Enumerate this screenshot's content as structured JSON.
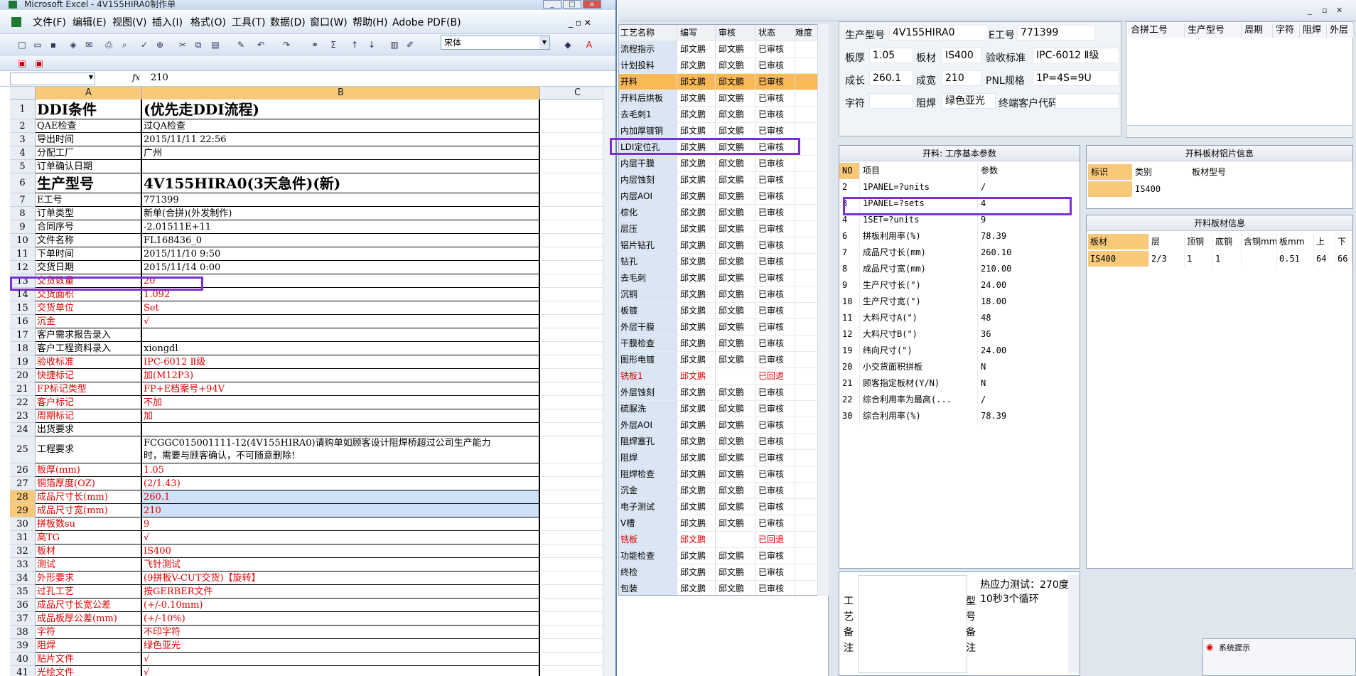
{
  "excel": {
    "title": "Microsoft Excel - 4V155HIRA0制作单",
    "window_buttons": [
      "_",
      "□",
      "×"
    ],
    "menu": [
      "文件(F)",
      "编辑(E)",
      "视图(V)",
      "插入(I)",
      "格式(O)",
      "工具(T)",
      "数据(D)",
      "窗口(W)",
      "帮助(H)",
      "Adobe PDF(B)"
    ],
    "font_name": "宋体",
    "formula_value": "210",
    "fx": "fx",
    "columns": [
      "A",
      "B",
      "C"
    ],
    "rows": [
      {
        "n": "1",
        "a": "DDI条件",
        "b": "(优先走DDI流程)",
        "big": true,
        "h": 28
      },
      {
        "n": "2",
        "a": "QAE检查",
        "b": "过QA检查",
        "h": 19
      },
      {
        "n": "3",
        "a": "导出时间",
        "b": "2015/11/11 22:56",
        "h": 19
      },
      {
        "n": "4",
        "a": "分配工厂",
        "b": "广州",
        "h": 19
      },
      {
        "n": "5",
        "a": "订单确认日期",
        "b": "",
        "h": 19
      },
      {
        "n": "6",
        "a": "生产型号",
        "b": "4V155HIRA0(3天急件)(新)",
        "big": true,
        "h": 28
      },
      {
        "n": "7",
        "a": "E工号",
        "b": "771399",
        "h": 19
      },
      {
        "n": "8",
        "a": "订单类型",
        "b": "新单(合拼)(外发制作)",
        "h": 19
      },
      {
        "n": "9",
        "a": "合同序号",
        "b": "-2.01511E+11",
        "h": 19
      },
      {
        "n": "10",
        "a": "文件名称",
        "b": "FL168436_0",
        "h": 19
      },
      {
        "n": "11",
        "a": "下单时间",
        "b": "2015/11/10 9:50",
        "h": 19
      },
      {
        "n": "12",
        "a": "交货日期",
        "b": "2015/11/14 0:00",
        "h": 19
      },
      {
        "n": "13",
        "a": "交货数量",
        "b": "20",
        "red": true,
        "h": 19
      },
      {
        "n": "14",
        "a": "交货面积",
        "b": "1.092",
        "red": true,
        "h": 19
      },
      {
        "n": "15",
        "a": "交货单位",
        "b": "Set",
        "red": true,
        "h": 19
      },
      {
        "n": "16",
        "a": "沉金",
        "b": "√",
        "red": true,
        "h": 19
      },
      {
        "n": "17",
        "a": "客户需求报告录入",
        "b": "",
        "h": 19
      },
      {
        "n": "18",
        "a": "客户工程资料录入",
        "b": "xiongdl",
        "h": 19
      },
      {
        "n": "19",
        "a": "验收标准",
        "b": "IPC-6012 Ⅱ级",
        "red": true,
        "h": 19
      },
      {
        "n": "20",
        "a": "快捷标记",
        "b": "加(M12P3)",
        "red": true,
        "h": 19
      },
      {
        "n": "21",
        "a": "FP标记类型",
        "b": "FP+E档案号+94V",
        "red": true,
        "h": 19
      },
      {
        "n": "22",
        "a": "客户标记",
        "b": "不加",
        "red": true,
        "h": 19
      },
      {
        "n": "23",
        "a": "周期标记",
        "b": "加",
        "red": true,
        "h": 19
      },
      {
        "n": "24",
        "a": "出货要求",
        "b": "",
        "h": 19
      },
      {
        "n": "25",
        "a": "工程要求",
        "b": "FCGGC015001111-12(4V155HIRA0)请购单如顾客设计阻焊桥超过公司生产能力",
        "b2": "时，需要与顾客确认，不可随意删除!",
        "h": 38
      },
      {
        "n": "26",
        "a": "板厚(mm)",
        "b": "1.05",
        "red": true,
        "h": 19
      },
      {
        "n": "27",
        "a": "铜箔厚度(OZ)",
        "b": "(2/1.43)",
        "red": true,
        "h": 19
      },
      {
        "n": "28",
        "a": "成品尺寸长(mm)",
        "b": "260.1",
        "red": true,
        "sel": true,
        "h": 19
      },
      {
        "n": "29",
        "a": "成品尺寸宽(mm)",
        "b": "210",
        "red": true,
        "sel": true,
        "h": 19
      },
      {
        "n": "30",
        "a": "拼板数su",
        "b": "9",
        "red": true,
        "h": 19
      },
      {
        "n": "31",
        "a": "高TG",
        "b": "√",
        "red": true,
        "h": 19
      },
      {
        "n": "32",
        "a": "板材",
        "b": "IS400",
        "red": true,
        "h": 19
      },
      {
        "n": "33",
        "a": "测试",
        "b": "飞针测试",
        "red": true,
        "h": 19
      },
      {
        "n": "34",
        "a": "外形要求",
        "b": "(9拼板V-CUT交货)【旋转】",
        "red": true,
        "h": 19
      },
      {
        "n": "35",
        "a": "过孔工艺",
        "b": "按GERBER文件",
        "red": true,
        "h": 19
      },
      {
        "n": "36",
        "a": "成品尺寸长宽公差",
        "b": "(+/-0.10mm)",
        "red": true,
        "h": 19
      },
      {
        "n": "37",
        "a": "成品板厚公差(mm)",
        "b": "(+/-10%)",
        "red": true,
        "h": 19
      },
      {
        "n": "38",
        "a": "字符",
        "b": "不印字符",
        "red": true,
        "h": 19
      },
      {
        "n": "39",
        "a": "阻焊",
        "b": "绿色亚光",
        "red": true,
        "h": 19
      },
      {
        "n": "40",
        "a": "贴片文件",
        "b": "√",
        "red": true,
        "h": 19
      },
      {
        "n": "41",
        "a": "光绘文件",
        "b": "√",
        "red": true,
        "h": 19
      }
    ]
  },
  "process": {
    "headers": [
      "工艺名称",
      "编写",
      "审核",
      "状态",
      "难度"
    ],
    "rows": [
      {
        "name": "流程指示",
        "w": "邱文鹏",
        "r": "邱文鹏",
        "s": "已审核"
      },
      {
        "name": "计划投料",
        "w": "邱文鹏",
        "r": "邱文鹏",
        "s": "已审核"
      },
      {
        "name": "开料",
        "w": "邱文鹏",
        "r": "邱文鹏",
        "s": "已审核",
        "sel": true
      },
      {
        "name": "开料后烘板",
        "w": "邱文鹏",
        "r": "邱文鹏",
        "s": "已审核"
      },
      {
        "name": "去毛刺1",
        "w": "邱文鹏",
        "r": "邱文鹏",
        "s": "已审核"
      },
      {
        "name": "内加厚镀铜",
        "w": "邱文鹏",
        "r": "邱文鹏",
        "s": "已审核"
      },
      {
        "name": "LDI定位孔",
        "w": "邱文鹏",
        "r": "邱文鹏",
        "s": "已审核"
      },
      {
        "name": "内层干膜",
        "w": "邱文鹏",
        "r": "邱文鹏",
        "s": "已审核"
      },
      {
        "name": "内层蚀刻",
        "w": "邱文鹏",
        "r": "邱文鹏",
        "s": "已审核"
      },
      {
        "name": "内层AOI",
        "w": "邱文鹏",
        "r": "邱文鹏",
        "s": "已审核"
      },
      {
        "name": "棕化",
        "w": "邱文鹏",
        "r": "邱文鹏",
        "s": "已审核"
      },
      {
        "name": "层压",
        "w": "邱文鹏",
        "r": "邱文鹏",
        "s": "已审核"
      },
      {
        "name": "铝片钻孔",
        "w": "邱文鹏",
        "r": "邱文鹏",
        "s": "已审核"
      },
      {
        "name": "钻孔",
        "w": "邱文鹏",
        "r": "邱文鹏",
        "s": "已审核"
      },
      {
        "name": "去毛刺",
        "w": "邱文鹏",
        "r": "邱文鹏",
        "s": "已审核"
      },
      {
        "name": "沉铜",
        "w": "邱文鹏",
        "r": "邱文鹏",
        "s": "已审核"
      },
      {
        "name": "板镀",
        "w": "邱文鹏",
        "r": "邱文鹏",
        "s": "已审核"
      },
      {
        "name": "外层干膜",
        "w": "邱文鹏",
        "r": "邱文鹏",
        "s": "已审核"
      },
      {
        "name": "干膜检查",
        "w": "邱文鹏",
        "r": "邱文鹏",
        "s": "已审核"
      },
      {
        "name": "图形电镀",
        "w": "邱文鹏",
        "r": "邱文鹏",
        "s": "已审核"
      },
      {
        "name": "铣板1",
        "w": "邱文鹏",
        "r": "",
        "s": "已回退",
        "rej": true
      },
      {
        "name": "外层蚀刻",
        "w": "邱文鹏",
        "r": "邱文鹏",
        "s": "已审核"
      },
      {
        "name": "硫脲洗",
        "w": "邱文鹏",
        "r": "邱文鹏",
        "s": "已审核"
      },
      {
        "name": "外层AOI",
        "w": "邱文鹏",
        "r": "邱文鹏",
        "s": "已审核"
      },
      {
        "name": "阻焊塞孔",
        "w": "邱文鹏",
        "r": "邱文鹏",
        "s": "已审核"
      },
      {
        "name": "阻焊",
        "w": "邱文鹏",
        "r": "邱文鹏",
        "s": "已审核"
      },
      {
        "name": "阻焊检查",
        "w": "邱文鹏",
        "r": "邱文鹏",
        "s": "已审核"
      },
      {
        "name": "沉金",
        "w": "邱文鹏",
        "r": "邱文鹏",
        "s": "已审核"
      },
      {
        "name": "电子测试",
        "w": "邱文鹏",
        "r": "邱文鹏",
        "s": "已审核"
      },
      {
        "name": "V槽",
        "w": "邱文鹏",
        "r": "邱文鹏",
        "s": "已审核"
      },
      {
        "name": "铣板",
        "w": "邱文鹏",
        "r": "",
        "s": "已回退",
        "rej": true
      },
      {
        "name": "功能检查",
        "w": "邱文鹏",
        "r": "邱文鹏",
        "s": "已审核"
      },
      {
        "name": "终检",
        "w": "邱文鹏",
        "r": "邱文鹏",
        "s": "已审核"
      },
      {
        "name": "包装",
        "w": "邱文鹏",
        "r": "邱文鹏",
        "s": "已审核"
      }
    ]
  },
  "info": {
    "model_label": "生产型号",
    "model": "4V155HIRA0",
    "e_label": "E工号",
    "e": "771399",
    "thick_label": "板厚",
    "thick": "1.05",
    "mat_label": "板材",
    "mat": "IS400",
    "std_label": "验收标准",
    "std": "IPC-6012 Ⅱ级",
    "len_label": "成长",
    "len": "260.1",
    "wid_label": "成宽",
    "wid": "210",
    "pnl_label": "PNL规格",
    "pnl": "1P=4S=9U",
    "char_label": "字符",
    "char": "",
    "mask_label": "阻焊",
    "mask": "绿色亚光",
    "cust_label": "终端客户代码",
    "cust": ""
  },
  "merge_headers": [
    "合拼工号",
    "生产型号",
    "周期",
    "字符",
    "阻焊",
    "外层"
  ],
  "params": {
    "title": "开料: 工序基本参数",
    "headers": [
      "NO",
      "项目",
      "参数"
    ],
    "rows": [
      {
        "no": "2",
        "k": "1PANEL=?units",
        "v": "/"
      },
      {
        "no": "3",
        "k": "1PANEL=?sets",
        "v": "4"
      },
      {
        "no": "4",
        "k": "1SET=?units",
        "v": "9"
      },
      {
        "no": "6",
        "k": "拼板利用率(%)",
        "v": "78.39"
      },
      {
        "no": "7",
        "k": "成品尺寸长(mm)",
        "v": "260.10"
      },
      {
        "no": "8",
        "k": "成品尺寸宽(mm)",
        "v": "210.00"
      },
      {
        "no": "9",
        "k": "生产尺寸长(\")",
        "v": "24.00"
      },
      {
        "no": "10",
        "k": "生产尺寸宽(\")",
        "v": "18.00"
      },
      {
        "no": "11",
        "k": "大料尺寸A(\")",
        "v": "48"
      },
      {
        "no": "12",
        "k": "大料尺寸B(\")",
        "v": "36"
      },
      {
        "no": "19",
        "k": "纬向尺寸(\")",
        "v": "24.00"
      },
      {
        "no": "20",
        "k": "小交货面积拼板",
        "v": "N"
      },
      {
        "no": "21",
        "k": "顾客指定板材(Y/N)",
        "v": "N"
      },
      {
        "no": "22",
        "k": "综合利用率为最高(...",
        "v": "/"
      },
      {
        "no": "30",
        "k": "综合利用率(%)",
        "v": "78.39"
      }
    ]
  },
  "cutting_sheet": {
    "title": "开料板材铝片信息",
    "headers": [
      "标识",
      "类别",
      "板材型号"
    ],
    "row": [
      "",
      "IS400",
      ""
    ]
  },
  "cutting_info": {
    "title": "开料板材信息",
    "headers": [
      "板材",
      "层",
      "顶铜",
      "底铜",
      "含铜mm",
      "板mm",
      "上",
      "下"
    ],
    "row": [
      "IS400",
      "2/3",
      "1",
      "1",
      "",
      "0.51",
      "64",
      "66"
    ]
  },
  "remark": {
    "label1": "工艺备注",
    "label2": "型号备注",
    "text": "热应力测试：270度10秒3个循环"
  },
  "notification": "系统提示",
  "colors": {
    "highlight_box": "#7b2fd0",
    "selected_row": "#f9b955",
    "reject": "#e00000"
  }
}
